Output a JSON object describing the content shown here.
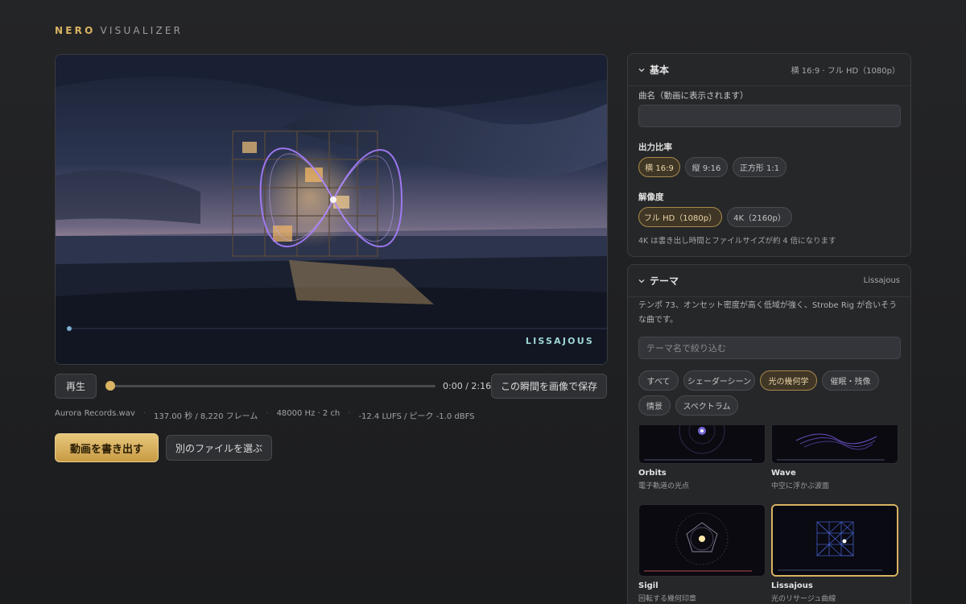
{
  "brand": {
    "name_bold": "NERO",
    "name_light": "VISUALIZER",
    "accent": "#d9b362"
  },
  "preview": {
    "overlay_label": "LISSAJOUS"
  },
  "transport": {
    "play_label": "再生",
    "time": "0:00 / 2:16",
    "progress": 0,
    "save_frame_label": "この瞬間を画像で保存"
  },
  "meta": {
    "file": "Aurora Records.wav",
    "duration": "137.00 秒 / 8,220 フレーム",
    "format": "48000 Hz · 2 ch",
    "loudness": "-12.4 LUFS / ピーク -1.0 dBFS"
  },
  "actions": {
    "export_label": "動画を書き出す",
    "choose_label": "別のファイルを選ぶ"
  },
  "basic": {
    "title": "基本",
    "summary": "横 16:9 · フル HD（1080p）",
    "song_label": "曲名（動画に表示されます）",
    "song_value": "",
    "ratio_label": "出力比率",
    "ratios": [
      "横 16:9",
      "縦 9:16",
      "正方形 1:1"
    ],
    "ratio_selected": "横 16:9",
    "res_label": "解像度",
    "resolutions": [
      "フル HD（1080p）",
      "4K（2160p）"
    ],
    "res_selected": "フル HD（1080p）",
    "res_hint": "4K は書き出し時間とファイルサイズが約 4 倍になります"
  },
  "theme": {
    "title": "テーマ",
    "current": "Lissajous",
    "description": "テンポ 73、オンセット密度が高く低域が強く、Strobe Rig が合いそうな曲です。",
    "search_placeholder": "テーマ名で絞り込む",
    "filters": [
      "すべて",
      "シェーダーシーン",
      "光の幾何学",
      "催眠・残像",
      "情景",
      "スペクトラム"
    ],
    "filter_selected": "光の幾何学",
    "cards": [
      {
        "name": "Orbits",
        "desc": "電子軌道の光点",
        "icon": "orbits-thumbnail"
      },
      {
        "name": "Wave",
        "desc": "中空に浮かぶ波面",
        "icon": "wave-thumbnail"
      },
      {
        "name": "Sigil",
        "desc": "回転する幾何印章",
        "icon": "sigil-thumbnail"
      },
      {
        "name": "Lissajous",
        "desc": "光のリサージュ曲線",
        "icon": "lissajous-thumbnail",
        "selected": true
      }
    ]
  }
}
